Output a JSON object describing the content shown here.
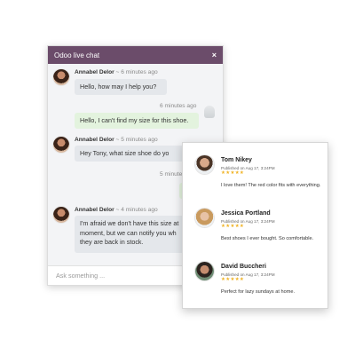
{
  "chat": {
    "title": "Odoo live chat",
    "close_icon": "×",
    "input_placeholder": "Ask something ...",
    "header_color": "#6b4c6a",
    "messages": [
      {
        "sender": "Annabel Delor",
        "ago": "~ 6 minutes ago",
        "text": "Hello, how may I help you?"
      },
      {
        "time": "6 minutes ago",
        "text": "Hello, I can't find my size for this shoe."
      },
      {
        "sender": "Annabel Delor",
        "ago": "~ 5 minutes ago",
        "text": "Hey Tony, what size shoe do yo"
      },
      {
        "time": "5 minute"
      },
      {
        "sender": "Annabel Delor",
        "ago": "~ 4 minutes ago",
        "line1": "I'm afraid we don't have this size at",
        "line2": "moment, but we can notify you wh",
        "line3": "they are back in stock."
      }
    ]
  },
  "reviews": [
    {
      "name": "Tom Nikey",
      "date": "Published on Aug 17, 3:24PM",
      "stars": "★★★★★",
      "text": "I love them! The red color fits with everything."
    },
    {
      "name": "Jessica Portland",
      "date": "Published on Aug 17, 3:24PM",
      "stars": "★★★★★",
      "text": "Best shoes I ever bought. So comfortable."
    },
    {
      "name": "David Buccheri",
      "date": "Published on Aug 17, 3:24PM",
      "stars": "★★★★★",
      "text": "Perfect for lazy sundays at home."
    }
  ],
  "colors": {
    "star": "#f0b428",
    "bubble_in": "#e4e7eb",
    "bubble_out": "#e3f3de"
  }
}
